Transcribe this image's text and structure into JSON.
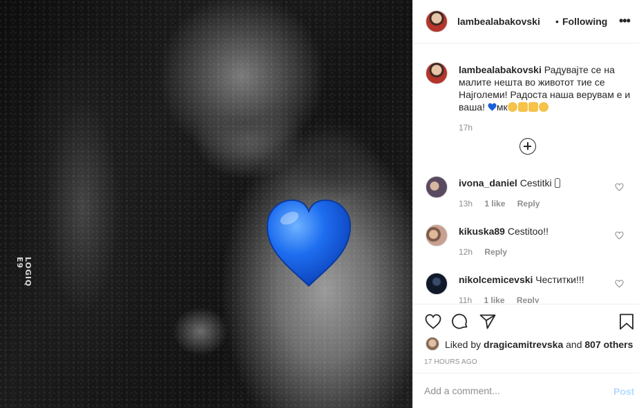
{
  "media": {
    "watermark_line1": "LOGIQ",
    "watermark_line2": "E9",
    "overlay_icon": "blue-heart-icon",
    "overlay_color": "#1a5fd8"
  },
  "header": {
    "username": "lambealabakovski",
    "separator": "•",
    "follow_status": "Following",
    "more_icon": "ellipsis-icon"
  },
  "caption": {
    "username": "lambealabakovski",
    "text": "Радувајте се на малите нешта во животот тие се Најголеми! Радоста наша верувам е и ваша!",
    "suffix": "мк",
    "time": "17h"
  },
  "load_more_icon": "plus-circle-icon",
  "comments": [
    {
      "username": "ivona_daniel",
      "text": "Cestitki",
      "time": "13h",
      "likes": "1 like",
      "reply": "Reply"
    },
    {
      "username": "kikuska89",
      "text": "Cestitoo!!",
      "time": "12h",
      "likes": "",
      "reply": "Reply"
    },
    {
      "username": "nikolcemicevski",
      "text": "Честитки!!!",
      "time": "11h",
      "likes": "1 like",
      "reply": "Reply"
    }
  ],
  "actions": {
    "like_icon": "heart-outline-icon",
    "comment_icon": "speech-bubble-icon",
    "share_icon": "paper-plane-icon",
    "save_icon": "bookmark-icon",
    "liked_by_prefix": "Liked by",
    "liked_by_user": "dragicamitrevska",
    "liked_by_and": "and",
    "liked_by_others": "807 others",
    "post_time": "17 HOURS AGO"
  },
  "add_comment": {
    "placeholder": "Add a comment...",
    "post_label": "Post",
    "post_color": "#b3dbff"
  },
  "colors": {
    "text": "#262626",
    "secondary": "#8e8e8e",
    "border": "#efefef"
  }
}
